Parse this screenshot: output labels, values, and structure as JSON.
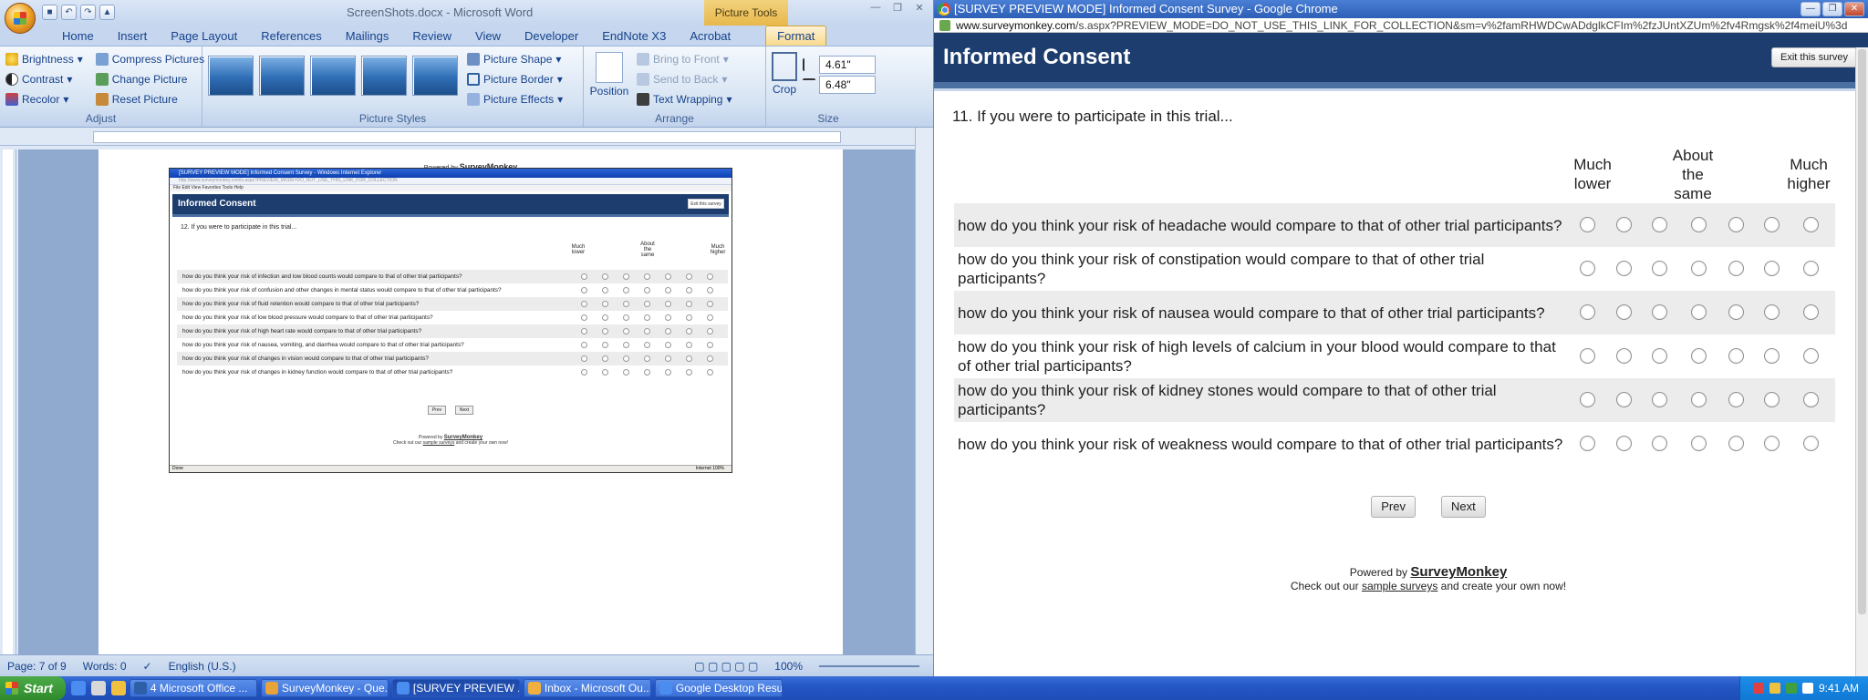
{
  "word": {
    "title": "ScreenShots.docx - Microsoft Word",
    "context_tab": "Picture Tools",
    "tabs": [
      "Home",
      "Insert",
      "Page Layout",
      "References",
      "Mailings",
      "Review",
      "View",
      "Developer",
      "EndNote X3",
      "Acrobat",
      "Format"
    ],
    "active_tab": "Format",
    "adjust": {
      "label": "Adjust",
      "brightness": "Brightness",
      "contrast": "Contrast",
      "recolor": "Recolor",
      "compress": "Compress Pictures",
      "change": "Change Picture",
      "reset": "Reset Picture"
    },
    "styles": {
      "label": "Picture Styles",
      "shape": "Picture Shape",
      "border": "Picture Border",
      "effects": "Picture Effects"
    },
    "arrange": {
      "label": "Arrange",
      "position": "Position",
      "front": "Bring to Front",
      "back": "Send to Back",
      "wrap": "Text Wrapping"
    },
    "size": {
      "label": "Size",
      "crop": "Crop",
      "height": "4.61\"",
      "width": "6.48\""
    },
    "doc": {
      "powered_by": "Powered by",
      "brand": "SurveyMonkey",
      "check_pre": "Check out our",
      "check_link": "sample surveys",
      "check_post": "and create your own now!"
    },
    "embedded": {
      "title": "[SURVEY PREVIEW MODE] Informed Consent Survey - Windows Internet Explorer",
      "url": "http://www.surveymonkey.com/s.aspx?PREVIEW_MODE=DO_NOT_USE_THIS_LINK_FOR_COLLECTION",
      "menu": "File  Edit  View  Favorites  Tools  Help",
      "header": "Informed Consent",
      "exit": "Exit this survey",
      "question": "12. If you were to participate in this trial...",
      "col_low": "Much lower",
      "col_mid": "About the same",
      "col_high": "Much higher",
      "rows": [
        "how do you think your risk of infection and low blood counts would compare to that of other trial participants?",
        "how do you think your risk of confusion and other changes in mental status would compare to that of other trial participants?",
        "how do you think your risk of fluid retention would compare to that of other trial participants?",
        "how do you think your risk of low blood pressure would compare to that of other trial participants?",
        "how do you think your risk of high heart rate would compare to that of other trial participants?",
        "how do you think your risk of nausea, vomiting, and diarrhea would compare to that of other trial participants?",
        "how do you think your risk of changes in vision would compare to that of other trial participants?",
        "how do you think your risk of changes in kidney function would compare to that of other trial participants?"
      ],
      "prev": "Prev",
      "next": "Next",
      "status_left": "Done",
      "status_right": "Internet  100%"
    },
    "status": {
      "page": "Page: 7 of 9",
      "words": "Words: 0",
      "lang": "English (U.S.)",
      "zoom": "100%"
    }
  },
  "chrome": {
    "title": "[SURVEY PREVIEW MODE] Informed Consent Survey - Google Chrome",
    "url_domain": "www.surveymonkey.com",
    "url_rest": "/s.aspx?PREVIEW_MODE=DO_NOT_USE_THIS_LINK_FOR_COLLECTION&sm=v%2famRHWDCwADdglkCFIm%2fzJUntXZUm%2fv4Rmgsk%2f4meiU%3d",
    "survey": {
      "header": "Informed Consent",
      "exit": "Exit this survey",
      "question": "11. If you were to participate in this trial...",
      "col_low": [
        "Much",
        "lower"
      ],
      "col_mid": [
        "About",
        "the",
        "same"
      ],
      "col_high": [
        "Much",
        "higher"
      ],
      "rows": [
        "how do you think your risk of headache would compare to that of other trial participants?",
        "how do you think your risk of constipation would compare to that of other trial participants?",
        "how do you think your risk of nausea would compare to that of other trial participants?",
        "how do you think your risk of high levels of calcium in your blood would compare to that of other trial participants?",
        "how do you think your risk of kidney stones would compare to that of other trial participants?",
        "how do you think your risk of weakness would compare to that of other trial participants?"
      ],
      "prev": "Prev",
      "next": "Next",
      "powered_by": "Powered by",
      "brand": "SurveyMonkey",
      "check_pre": "Check out our",
      "check_link": "sample surveys",
      "check_post": "and create your own now!"
    }
  },
  "taskbar": {
    "start": "Start",
    "items": [
      "4 Microsoft Office ...",
      "SurveyMonkey - Que...",
      "[SURVEY PREVIEW ...",
      "Inbox - Microsoft Ou...",
      "Google Desktop Results"
    ],
    "active_item": 2,
    "time": "9:41 AM"
  }
}
